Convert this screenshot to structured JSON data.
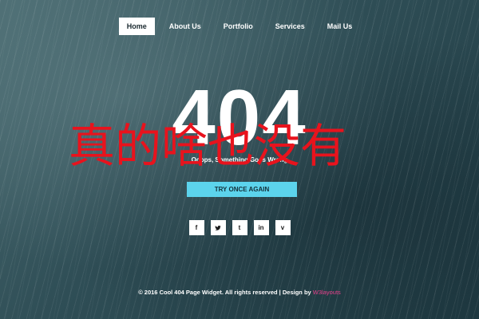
{
  "nav": {
    "items": [
      {
        "label": "Home",
        "active": true
      },
      {
        "label": "About Us",
        "active": false
      },
      {
        "label": "Portfolio",
        "active": false
      },
      {
        "label": "Services",
        "active": false
      },
      {
        "label": "Mail Us",
        "active": false
      }
    ]
  },
  "hero": {
    "code": "404",
    "message": "Ooops, Something Goes Wrong",
    "overlay_text": "真的啥也没有",
    "button_label": "TRY ONCE AGAIN"
  },
  "social": {
    "icons": [
      {
        "glyph": "f",
        "icon": "facebook-icon"
      },
      {
        "glyph": "𝕥",
        "icon": "twitter-icon"
      },
      {
        "glyph": "t",
        "icon": "tumblr-icon"
      },
      {
        "glyph": "in",
        "icon": "linkedin-icon"
      },
      {
        "glyph": "v",
        "icon": "vimeo-icon"
      }
    ]
  },
  "footer": {
    "text": "© 2016 Cool 404 Page Widget. All rights reserved | Design by ",
    "credit": "W3layouts"
  },
  "colors": {
    "accent_button": "#5cd3ec",
    "overlay_red": "#e8131d",
    "credit_pink": "#e8418c"
  }
}
